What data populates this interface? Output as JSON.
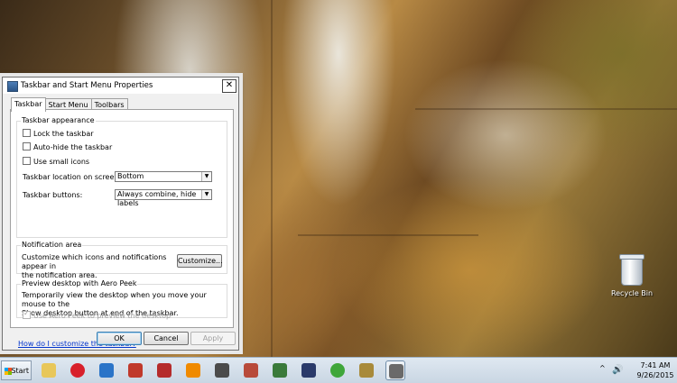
{
  "dialog": {
    "title": "Taskbar and Start Menu Properties",
    "close_glyph": "✕",
    "tabs": [
      {
        "label": "Taskbar"
      },
      {
        "label": "Start Menu"
      },
      {
        "label": "Toolbars"
      }
    ],
    "appearance": {
      "legend": "Taskbar appearance",
      "lock_label": "Lock the taskbar",
      "lock_checked": false,
      "autohide_label": "Auto-hide the taskbar",
      "autohide_checked": false,
      "small_icons_label": "Use small icons",
      "small_icons_checked": false,
      "location_label": "Taskbar location on screen:",
      "location_value": "Bottom",
      "buttons_label": "Taskbar buttons:",
      "buttons_value": "Always combine, hide labels"
    },
    "notification": {
      "legend": "Notification area",
      "text_line1": "Customize which icons and notifications appear in",
      "text_line2": "the notification area.",
      "customize_button": "Customize..."
    },
    "aero_peek": {
      "legend": "Preview desktop with Aero Peek",
      "text_line1": "Temporarily view the desktop when you move your mouse to the",
      "text_line2": "Show desktop button at end of the taskbar.",
      "checkbox_label": "Use Aero Peek to preview the desktop",
      "checkbox_checked": true,
      "checkbox_disabled": true
    },
    "help_link": "How do I customize the taskbar?",
    "buttons": {
      "ok": "OK",
      "cancel": "Cancel",
      "apply": "Apply"
    }
  },
  "desktop": {
    "recycle_bin_label": "Recycle Bin"
  },
  "taskbar": {
    "start_label": "Start",
    "pinned": [
      {
        "name": "file-explorer-icon",
        "color": "#e8c75a"
      },
      {
        "name": "opera-icon",
        "color": "#d8202b"
      },
      {
        "name": "network-icon",
        "color": "#2a74c8"
      },
      {
        "name": "ccleaner-icon",
        "color": "#c0392b"
      },
      {
        "name": "media-player-icon",
        "color": "#b52b2b"
      },
      {
        "name": "vlc-icon",
        "color": "#f08a00"
      },
      {
        "name": "utility-icon",
        "color": "#4b4b4b"
      },
      {
        "name": "molecule-icon",
        "color": "#b84a3a"
      },
      {
        "name": "display-icon",
        "color": "#3a7a3a"
      },
      {
        "name": "monitor-icon",
        "color": "#2a3a6a"
      },
      {
        "name": "utorrent-icon",
        "color": "#3fa63a"
      },
      {
        "name": "home-icon",
        "color": "#a88a3a"
      },
      {
        "name": "properties-window-icon",
        "color": "#6a6a6a"
      }
    ],
    "tray": {
      "overflow_glyph": "^",
      "volume_glyph": "🔊",
      "time": "7:41 AM",
      "date": "9/26/2015"
    }
  }
}
